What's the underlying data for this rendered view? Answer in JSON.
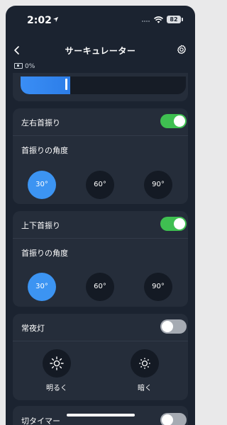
{
  "status": {
    "time": "2:02",
    "battery": "82"
  },
  "header": {
    "title": "サーキュレーター"
  },
  "device": {
    "battery_text": "0%"
  },
  "speed_slider": {
    "value_fraction": 0.3
  },
  "colors": {
    "background": "#1b2330",
    "card": "#252d3a",
    "accent": "#3c94f2",
    "toggle_on": "#3fbf51",
    "toggle_off": "#a6abb3"
  },
  "horizontal_swing": {
    "label": "左右首振り",
    "enabled": true,
    "angle_label": "首振りの角度",
    "options": [
      "30°",
      "60°",
      "90°"
    ],
    "selected": "30°"
  },
  "vertical_swing": {
    "label": "上下首振り",
    "enabled": true,
    "angle_label": "首振りの角度",
    "options": [
      "30°",
      "60°",
      "90°"
    ],
    "selected": "30°"
  },
  "night_light": {
    "label": "常夜灯",
    "enabled": false,
    "bright_label": "明るく",
    "dim_label": "暗く",
    "bright_icon": "sun-bright-icon",
    "dim_icon": "sun-dim-icon"
  },
  "off_timer": {
    "label": "切タイマー",
    "enabled": false
  }
}
